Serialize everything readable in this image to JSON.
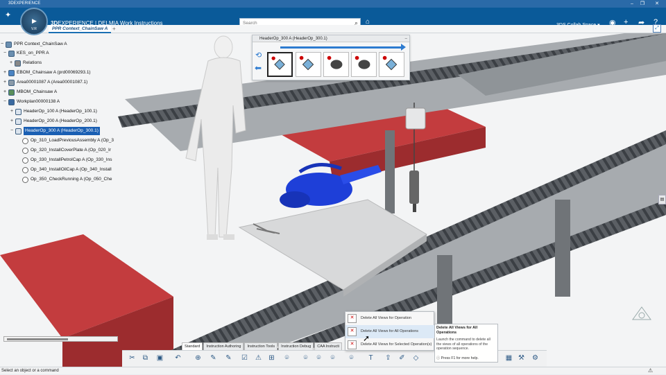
{
  "window": {
    "title": "3DEXPERIENCE",
    "controls": [
      "–",
      "❐",
      "✕"
    ]
  },
  "compass": {
    "version": "V.R"
  },
  "brand": {
    "bold": "3D",
    "name": "EXPERIENCE | DELMIA",
    "app": "Work Instructions"
  },
  "search": {
    "placeholder": "Search"
  },
  "topbar": {
    "collab_space": "3DS Collab Space"
  },
  "tab": {
    "label": "PPR Context_ChainSaw A",
    "add": "+"
  },
  "tree": {
    "nodes": [
      {
        "label": "PPR Context_ChainSaw A"
      },
      {
        "label": "KES_on_PPR A"
      },
      {
        "label": "Relations"
      },
      {
        "label": "EBOM_Chainsaw A (prd00069293.1)"
      },
      {
        "label": "Area00001087 A (Area00001087.1)"
      },
      {
        "label": "MBOM_Chainsaw A"
      },
      {
        "label": "Workplan00000138 A"
      },
      {
        "label": "HeaderOp_100 A (HeaderOp_100.1)"
      },
      {
        "label": "HeaderOp_200 A (HeaderOp_200.1)"
      },
      {
        "label": "HeaderOp_300 A (HeaderOp_300.1)"
      },
      {
        "label": "Op_310_LoadPreviousAssembly A (Op_3"
      },
      {
        "label": "Op_320_InstallCoverPlate A (Op_020_Ir"
      },
      {
        "label": "Op_330_InstallPetrolCap A (Op_330_Ins"
      },
      {
        "label": "Op_340_InstallOilCap A (Op_340_Install"
      },
      {
        "label": "Op_350_CheckRunning A (Op_050_Che"
      }
    ]
  },
  "panel": {
    "title": "HeaderOp_300 A (HeaderOp_300.1)",
    "close": "–"
  },
  "context_menu": {
    "items": [
      {
        "label": "Delete All Views for Operation"
      },
      {
        "label": "Delete All Views for All Operations"
      },
      {
        "label": "Delete All Views for Selected Operation(s)"
      }
    ]
  },
  "tooltip": {
    "title": "Delete All Views for All Operations",
    "description": "Launch the command to delete all the views of all operations of the operation sequence.",
    "help": "Press F1 for more help."
  },
  "action_bar": {
    "tabs": [
      "Standard",
      "Instruction Authoring",
      "Instruction Tools",
      "Instruction Debug",
      "CAA Instructi"
    ]
  },
  "status": {
    "text": "Select an object or a command"
  },
  "colors": {
    "brand_blue": "#0a5a99",
    "title_blue": "#2a6aa8",
    "selection": "#1a5fb3",
    "conveyor_red": "#c8383a",
    "part_blue": "#1e3fd8"
  }
}
